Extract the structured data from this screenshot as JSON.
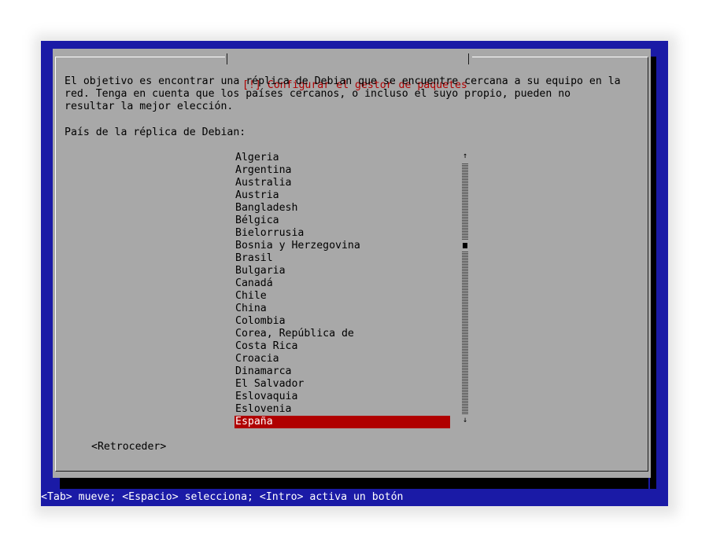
{
  "dialog": {
    "title": "[!] Configurar el gestor de paquetes",
    "intro_line1": "El objetivo es encontrar una réplica de Debian que se encuentre cercana a su equipo en la",
    "intro_line2": "red. Tenga en cuenta que los países cercanos, o incluso el suyo propio, pueden no",
    "intro_line3": "resultar la mejor elección.",
    "prompt": "País de la réplica de Debian:",
    "countries": [
      "Algeria",
      "Argentina",
      "Australia",
      "Austria",
      "Bangladesh",
      "Bélgica",
      "Bielorrusia",
      "Bosnia y Herzegovina",
      "Brasil",
      "Bulgaria",
      "Canadá",
      "Chile",
      "China",
      "Colombia",
      "Corea, República de",
      "Costa Rica",
      "Croacia",
      "Dinamarca",
      "El Salvador",
      "Eslovaquia",
      "Eslovenia",
      "España"
    ],
    "selected_country": "España",
    "scroll_up_glyph": "↑",
    "scroll_down_glyph": "↓",
    "back_button": "<Retroceder>"
  },
  "statusbar": {
    "text": "<Tab> mueve; <Espacio> selecciona; <Intro> activa un botón"
  },
  "colors": {
    "screen_background": "#1a1aa6",
    "dialog_background": "#a8a8a8",
    "title_color": "#b00000",
    "selection_background": "#b00000",
    "selection_text": "#ffffff"
  }
}
